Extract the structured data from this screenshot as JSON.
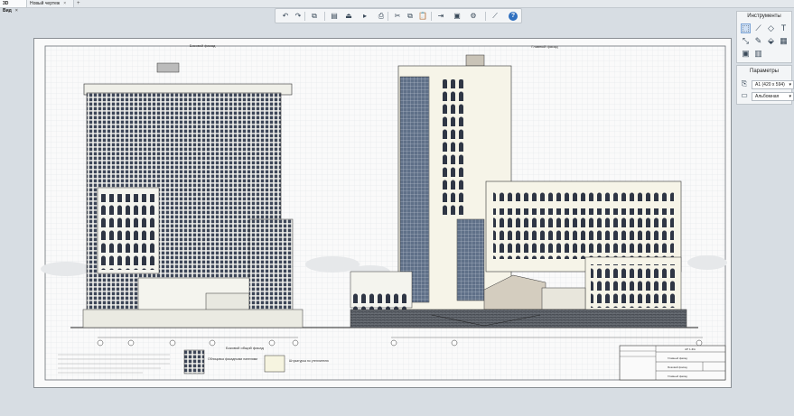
{
  "tabs": [
    {
      "label": "3D Вид",
      "close": "×"
    },
    {
      "label": "Новый чертеж",
      "close": "×"
    }
  ],
  "tab_add": "+",
  "toolbar": {
    "icons": [
      "undo-icon",
      "redo-icon",
      "copy-view-icon",
      "layers-icon",
      "print-preview-icon",
      "export-icon",
      "print-icon",
      "cut-icon",
      "copy-icon",
      "paste-icon",
      "align-icon",
      "frame-icon",
      "settings-icon",
      "measure-icon",
      "help-icon"
    ],
    "glyphs": [
      "↶",
      "↷",
      "⧉",
      "▤",
      "⏏",
      "▸",
      "⎙",
      "✂",
      "⧉",
      "📋",
      "⇥",
      "▣",
      "⚙",
      "⟋",
      "?"
    ]
  },
  "tools_panel": {
    "title": "Инструменты",
    "tools": [
      {
        "name": "select-tool-icon",
        "glyph": "⬚"
      },
      {
        "name": "line-tool-icon",
        "glyph": "⟋"
      },
      {
        "name": "shape-tool-icon",
        "glyph": "◇"
      },
      {
        "name": "text-tool-icon",
        "glyph": "T"
      },
      {
        "name": "dimension-tool-icon",
        "glyph": "⤡"
      },
      {
        "name": "pen-tool-icon",
        "glyph": "✎"
      },
      {
        "name": "fill-tool-icon",
        "glyph": "⬙"
      },
      {
        "name": "image-tool-icon",
        "glyph": "▦"
      },
      {
        "name": "view-tool-icon",
        "glyph": "▣"
      },
      {
        "name": "table-tool-icon",
        "glyph": "▥"
      }
    ]
  },
  "params_panel": {
    "title": "Параметры",
    "format_value": "А1 (420 х 594)",
    "orientation_value": "Альбомная"
  },
  "drawing": {
    "title_left": "Боковой фасад",
    "title_right": "Главный фасад",
    "label_left_bottom": "Боковой общий фасад",
    "legend_note_1": "Облицовка фасадными панелями",
    "legend_note_2": "Штукатурка по утеплителю",
    "stamp_code": "АР 1-ФА",
    "stamp_row_1": "Главный фасад",
    "stamp_row_2": "Боковой фасад",
    "stamp_row_3": "Главный фасад"
  }
}
